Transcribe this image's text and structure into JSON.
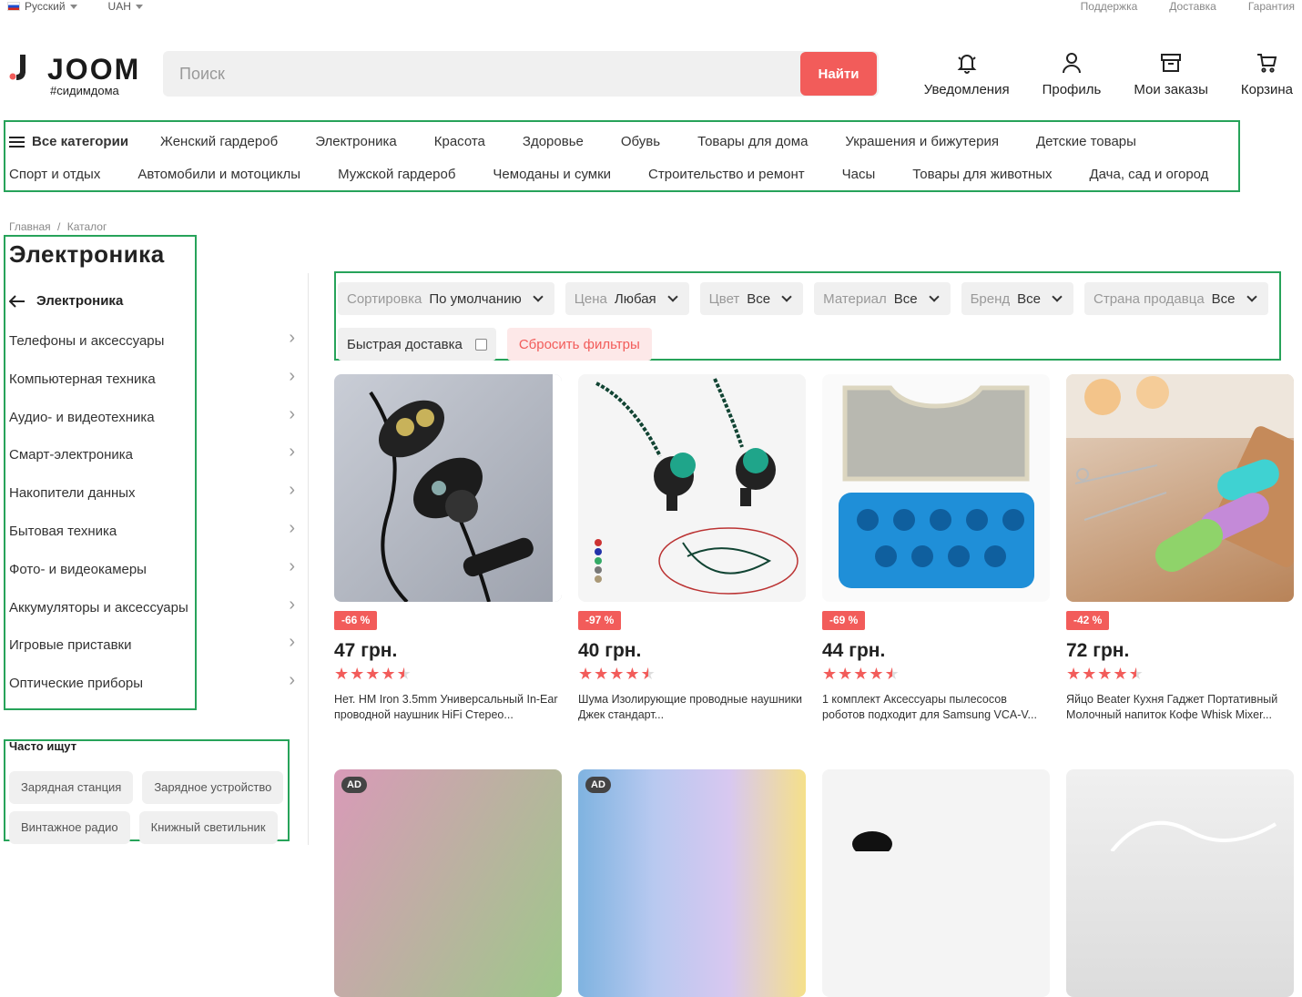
{
  "topbar": {
    "language": "Русский",
    "currency": "UAH",
    "links": [
      "Поддержка",
      "Доставка",
      "Гарантия"
    ]
  },
  "header": {
    "logo_text": "JOOM",
    "logo_tag": "#сидимдома",
    "search_placeholder": "Поиск",
    "search_button": "Найти",
    "icons": [
      {
        "label": "Уведомления",
        "icon": "bell-icon"
      },
      {
        "label": "Профиль",
        "icon": "user-icon"
      },
      {
        "label": "Мои заказы",
        "icon": "orders-box-icon"
      },
      {
        "label": "Корзина",
        "icon": "cart-icon"
      }
    ]
  },
  "categories": {
    "all": "Все категории",
    "row1": [
      "Женский гардероб",
      "Электроника",
      "Красота",
      "Здоровье",
      "Обувь",
      "Товары для дома",
      "Украшения и бижутерия",
      "Детские товары"
    ],
    "row2": [
      "Спорт и отдых",
      "Автомобили и мотоциклы",
      "Мужской гардероб",
      "Чемоданы и сумки",
      "Строительство и ремонт",
      "Часы",
      "Товары для животных",
      "Дача, сад и огород"
    ]
  },
  "breadcrumb": {
    "home": "Главная",
    "sep": "/",
    "catalog": "Каталог"
  },
  "sidebar": {
    "title": "Электроника",
    "back_label": "Электроника",
    "items": [
      "Телефоны и аксессуары",
      "Компьютерная техника",
      "Аудио- и видеотехника",
      "Смарт-электроника",
      "Накопители данных",
      "Бытовая техника",
      "Фото- и видеокамеры",
      "Аккумуляторы и аксессуары",
      "Игровые приставки",
      "Оптические приборы"
    ]
  },
  "popular": {
    "title": "Часто ищут",
    "chips": [
      "Зарядная станция",
      "Зарядное устройство",
      "Винтажное радио",
      "Книжный светильник"
    ]
  },
  "filters": {
    "sort": {
      "label": "Сортировка",
      "value": "По умолчанию"
    },
    "price": {
      "label": "Цена",
      "value": "Любая"
    },
    "color": {
      "label": "Цвет",
      "value": "Все"
    },
    "material": {
      "label": "Материал",
      "value": "Все"
    },
    "brand": {
      "label": "Бренд",
      "value": "Все"
    },
    "country": {
      "label": "Страна продавца",
      "value": "Все"
    },
    "fast_delivery": "Быстрая доставка",
    "reset": "Сбросить фильтры"
  },
  "products": [
    {
      "discount": "-66 %",
      "price": "47 грн.",
      "rating": 4.5,
      "title": "Нет. HM Iron 3.5mm Универсальный In-Ear проводной наушник HiFi Стерео..."
    },
    {
      "discount": "-97 %",
      "price": "40 грн.",
      "rating": 4.5,
      "title": "Шума Изолирующие проводные наушники Джек стандарт..."
    },
    {
      "discount": "-69 %",
      "price": "44 грн.",
      "rating": 4.5,
      "title": "1 комплект Аксессуары пылесосов роботов подходит для Samsung VCA-V..."
    },
    {
      "discount": "-42 %",
      "price": "72 грн.",
      "rating": 4.5,
      "title": "Яйцо Beater Кухня Гаджет Портативный Молочный напиток Кофе Whisk Mixer..."
    }
  ],
  "ad_label": "AD"
}
